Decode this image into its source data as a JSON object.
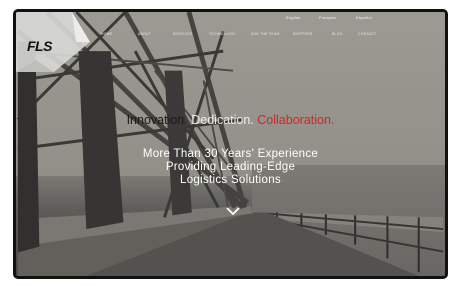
{
  "languages": [
    "English",
    "Français",
    "Español"
  ],
  "nav": [
    "HOME",
    "ABOUT",
    "SERVICES",
    "TECHNOLOGY",
    "JOIN THE TEAM",
    "SHIPPERS",
    "BLOG",
    "CONTACT"
  ],
  "logo": "FLS",
  "hero": {
    "word_innovation": "Innovation.",
    "word_dedication": "Dedication.",
    "word_collaboration": "Collaboration.",
    "line1": "More Than 30 Years' Experience",
    "line2": "Providing Leading-Edge",
    "line3": "Logistics Solutions"
  },
  "colors": {
    "accent": "#cc2a22",
    "frame": "#111111"
  },
  "icons": {
    "scroll_down": "chevron-down-icon"
  }
}
